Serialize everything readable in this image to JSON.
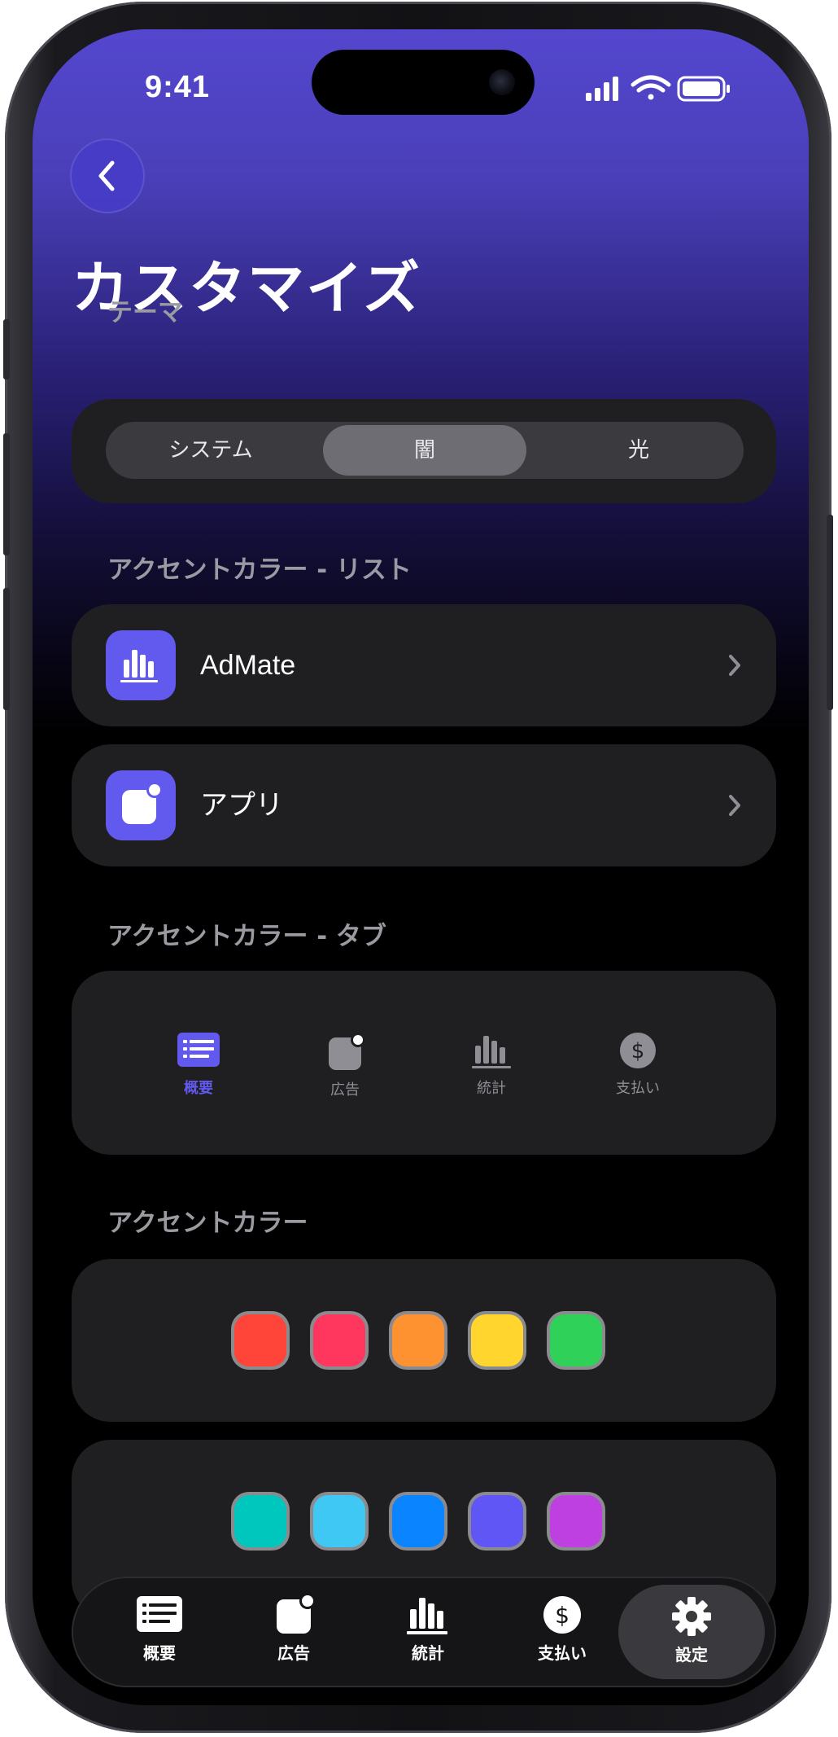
{
  "status_bar": {
    "time": "9:41"
  },
  "header": {
    "back_icon": "chevron-left-icon",
    "title": "カスタマイズ"
  },
  "theme": {
    "label": "テーマ",
    "options": [
      "システム",
      "闇",
      "光"
    ],
    "selected": "闇"
  },
  "accent_list": {
    "label": "アクセントカラー - リスト",
    "items": [
      {
        "label": "AdMate",
        "icon": "bar-chart-icon"
      },
      {
        "label": "アプリ",
        "icon": "app-badge-icon"
      }
    ]
  },
  "accent_tab": {
    "label": "アクセントカラー - タブ",
    "items": [
      {
        "label": "概要",
        "icon": "list-icon",
        "active": true
      },
      {
        "label": "広告",
        "icon": "app-badge-icon"
      },
      {
        "label": "統計",
        "icon": "bar-chart-icon"
      },
      {
        "label": "支払い",
        "icon": "dollar-icon"
      }
    ]
  },
  "accent_color": {
    "label": "アクセントカラー",
    "row1": [
      "#ff453a",
      "#ff375f",
      "#ff9230",
      "#ffd52e",
      "#30d158"
    ],
    "row2": [
      "#00c7be",
      "#40c8f4",
      "#0a84ff",
      "#6056f5",
      "#bf40e0"
    ]
  },
  "tab_bar": {
    "items": [
      {
        "label": "概要",
        "icon": "list-icon"
      },
      {
        "label": "広告",
        "icon": "app-badge-icon"
      },
      {
        "label": "統計",
        "icon": "bar-chart-icon"
      },
      {
        "label": "支払い",
        "icon": "dollar-icon"
      },
      {
        "label": "設定",
        "icon": "gear-icon",
        "active": true
      }
    ]
  },
  "colors": {
    "accent": "#6259ee",
    "card": "#1f1f22",
    "header_gradient_top": "#5447cf"
  }
}
